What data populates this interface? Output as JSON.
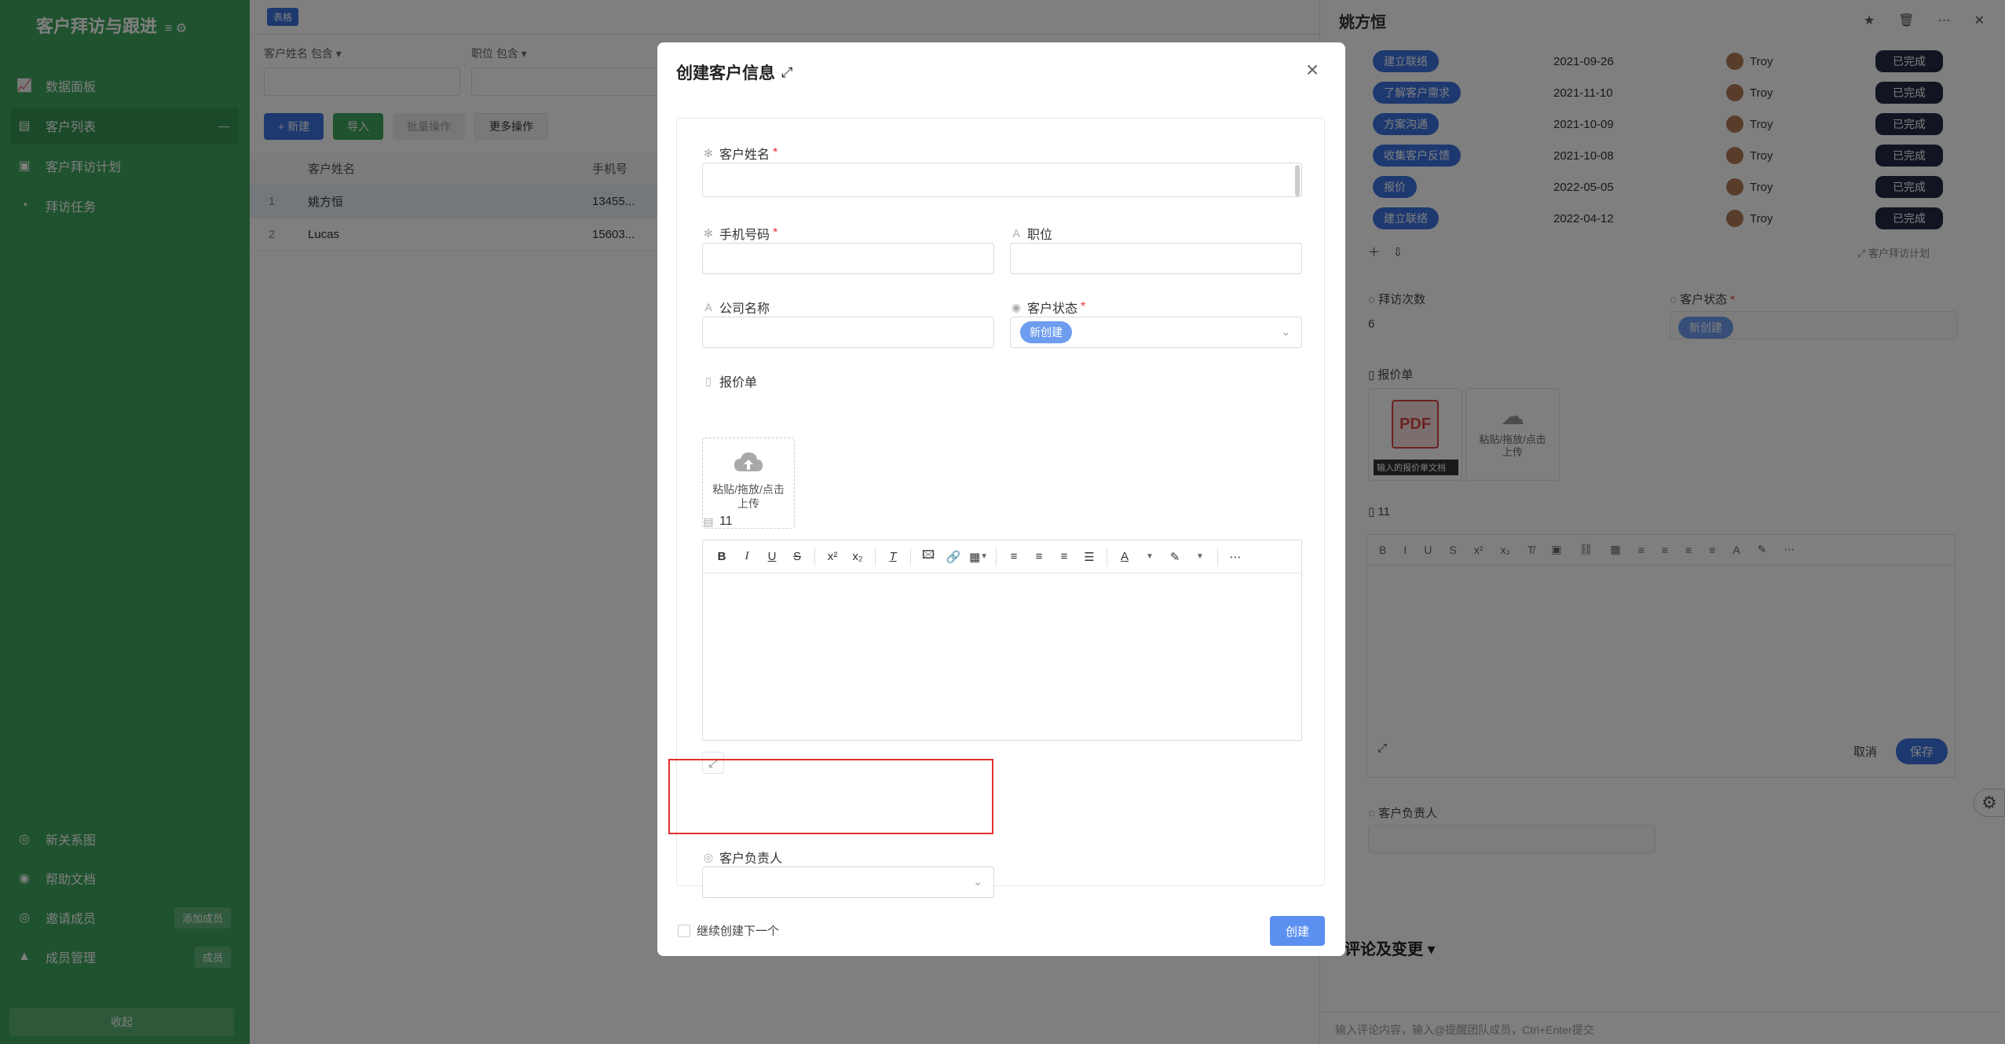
{
  "sidebar": {
    "title": "客户拜访与跟进",
    "title_tools": "≡ ⚙",
    "items": [
      {
        "label": "数据面板",
        "icon": "chart-icon"
      },
      {
        "label": "客户列表",
        "icon": "list-icon"
      },
      {
        "label": "客户拜访计划",
        "icon": "plan-icon"
      },
      {
        "label": "拜访任务",
        "icon": "task-icon"
      }
    ],
    "bottom_items": [
      {
        "label": "新关系图",
        "icon": "graph-icon"
      },
      {
        "label": "帮助文档",
        "icon": "help-icon"
      },
      {
        "label": "邀请成员",
        "icon": "invite-icon",
        "badge": "添加成员"
      },
      {
        "label": "成员管理",
        "icon": "members-icon",
        "badge": "成员"
      }
    ],
    "collapse_label": "收起"
  },
  "main": {
    "tab": "表格",
    "filters": [
      {
        "label": "客户姓名  包含 ▾"
      },
      {
        "label": "职位  包含 ▾"
      }
    ],
    "buttons": {
      "add": "+ 新建",
      "import": "导入",
      "batch": "批量操作",
      "more": "更多操作"
    },
    "table": {
      "headers": [
        "",
        "客户姓名",
        "手机号"
      ],
      "rows": [
        {
          "no": "1",
          "name": "姚方恒",
          "phone": "13455..."
        },
        {
          "no": "2",
          "name": "Lucas",
          "phone": "15603..."
        }
      ]
    }
  },
  "detail": {
    "title": "姚方恒",
    "rows": [
      {
        "status": "建立联络",
        "date": "2021-09-26",
        "user": "Troy",
        "state": "已完成"
      },
      {
        "status": "了解客户需求",
        "date": "2021-11-10",
        "user": "Troy",
        "state": "已完成"
      },
      {
        "status": "方案沟通",
        "date": "2021-10-09",
        "user": "Troy",
        "state": "已完成"
      },
      {
        "status": "收集客户反馈",
        "date": "2021-10-08",
        "user": "Troy",
        "state": "已完成"
      },
      {
        "status": "报价",
        "date": "2022-05-05",
        "user": "Troy",
        "state": "已完成"
      },
      {
        "status": "建立联络",
        "date": "2022-04-12",
        "user": "Troy",
        "state": "已完成"
      }
    ],
    "link_label": "客户拜访计划",
    "visits_label": "拜访次数",
    "visits_value": "6",
    "status_label": "客户状态",
    "status_value": "新创建",
    "quote_label": "报价单",
    "pdf_caption": "输入的报价单文档",
    "upload_text": "粘贴/拖放/点击上传",
    "field11_label": "11",
    "cancel": "取消",
    "save": "保存",
    "owner_label": "客户负责人",
    "comments_title": "评论及变更",
    "comment_placeholder": "输入评论内容，输入@提醒团队成员，Ctrl+Enter提交"
  },
  "modal": {
    "title": "创建客户信息",
    "fields": {
      "name": {
        "label": "客户姓名",
        "value": ""
      },
      "phone": {
        "label": "手机号码",
        "value": ""
      },
      "position": {
        "label": "职位",
        "value": ""
      },
      "company": {
        "label": "公司名称",
        "value": ""
      },
      "status": {
        "label": "客户状态",
        "value": "新创建"
      },
      "quote": {
        "label": "报价单"
      },
      "field11": {
        "label": "11"
      },
      "owner": {
        "label": "客户负责人",
        "value": ""
      }
    },
    "upload": {
      "text": "粘贴/拖放/点击上传"
    },
    "continue_label": "继续创建下一个",
    "create_label": "创建",
    "colors": {
      "primary": "#5b8ff0",
      "required": "#e33333",
      "highlight": "#e03030",
      "sidebar": "#3ea55d"
    }
  }
}
